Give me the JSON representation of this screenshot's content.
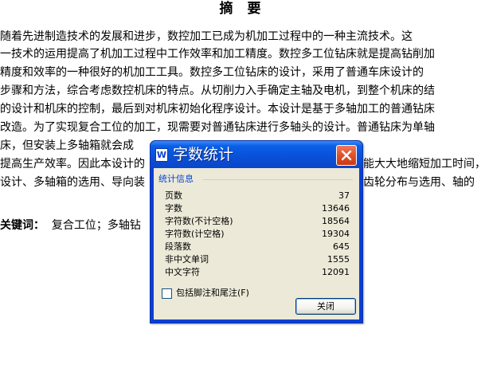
{
  "document": {
    "title": "摘 要",
    "lines": [
      "    随着先进制造技术的发展和进步，数控加工已成为机加工过程中的一种主流技术。这",
      "一技术的运用提高了机加工过程中工作效率和加工精度。数控多工位钻床就是提高钻削加",
      "精度和效率的一种很好的机加工工具。数控多工位钻床的设计，采用了普通车床设计的",
      "步骤和方法，综合考虑数控机床的特点。从切削力入手确定主轴及电机，到整个机床的结",
      "的设计和机床的控制，最后到对机床初始化程序设计。本设计是基于多轴加工的普通钻床",
      "改造。为了实现复合工位的加工，现需要对普通钻床进行多轴头的设计。普通钻床为单轴",
      "床，但安装上多轴箱就会成",
      "提高生产效率。因此本设计的",
      "设计、多轴箱的选用、导向装"
    ],
    "line_tails": [
      "能大大地缩短加工时间，",
      "齿轮分布与选用、轴的"
    ],
    "keywords_label": "关键词：",
    "keywords_text": "复合工位；多轴钻"
  },
  "dialog": {
    "title": "字数统计",
    "group_label": "统计信息",
    "stats": [
      {
        "label": "页数",
        "value": "37"
      },
      {
        "label": "字数",
        "value": "13646"
      },
      {
        "label": "字符数(不计空格)",
        "value": "18564"
      },
      {
        "label": "字符数(计空格)",
        "value": "19304"
      },
      {
        "label": "段落数",
        "value": "645"
      },
      {
        "label": "非中文单词",
        "value": "1555"
      },
      {
        "label": "中文字符",
        "value": "12091"
      }
    ],
    "checkbox_label": "包括脚注和尾注(F)",
    "checkbox_checked": false,
    "close_button_label": "关闭"
  }
}
